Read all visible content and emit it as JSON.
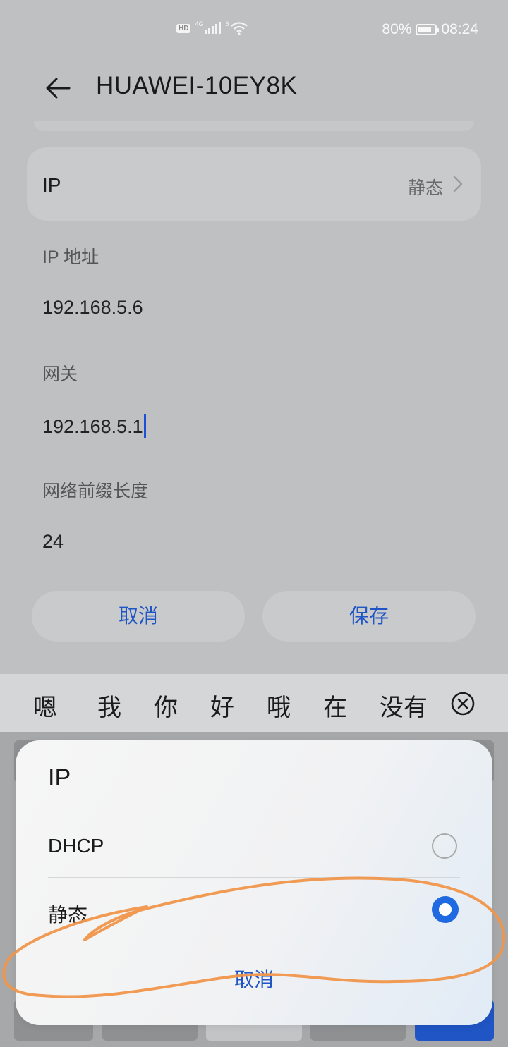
{
  "status_bar": {
    "hd": "HD",
    "signal": "4G",
    "wifi_badge": "6",
    "battery_percent": "80%",
    "battery_level": 0.8,
    "time": "08:24"
  },
  "header": {
    "title": "HUAWEI-10EY8K",
    "back_icon": "arrow-left-icon"
  },
  "ip_setting": {
    "label": "IP",
    "value": "静态"
  },
  "fields": {
    "ip_address": {
      "label": "IP 地址",
      "value": "192.168.5.6"
    },
    "gateway": {
      "label": "网关",
      "value": "192.168.5.1"
    },
    "prefix": {
      "label": "网络前缀长度",
      "value": "24"
    }
  },
  "buttons": {
    "cancel": "取消",
    "save": "保存"
  },
  "ime_candidates": [
    "嗯",
    "我",
    "你",
    "好",
    "哦",
    "在",
    "没有"
  ],
  "dialog": {
    "title": "IP",
    "options": [
      {
        "label": "DHCP",
        "selected": false
      },
      {
        "label": "静态",
        "selected": true
      }
    ],
    "cancel": "取消"
  },
  "colors": {
    "accent": "#1f55c4",
    "radio_selected": "#1f6ae0",
    "annotation": "#f0954a"
  }
}
